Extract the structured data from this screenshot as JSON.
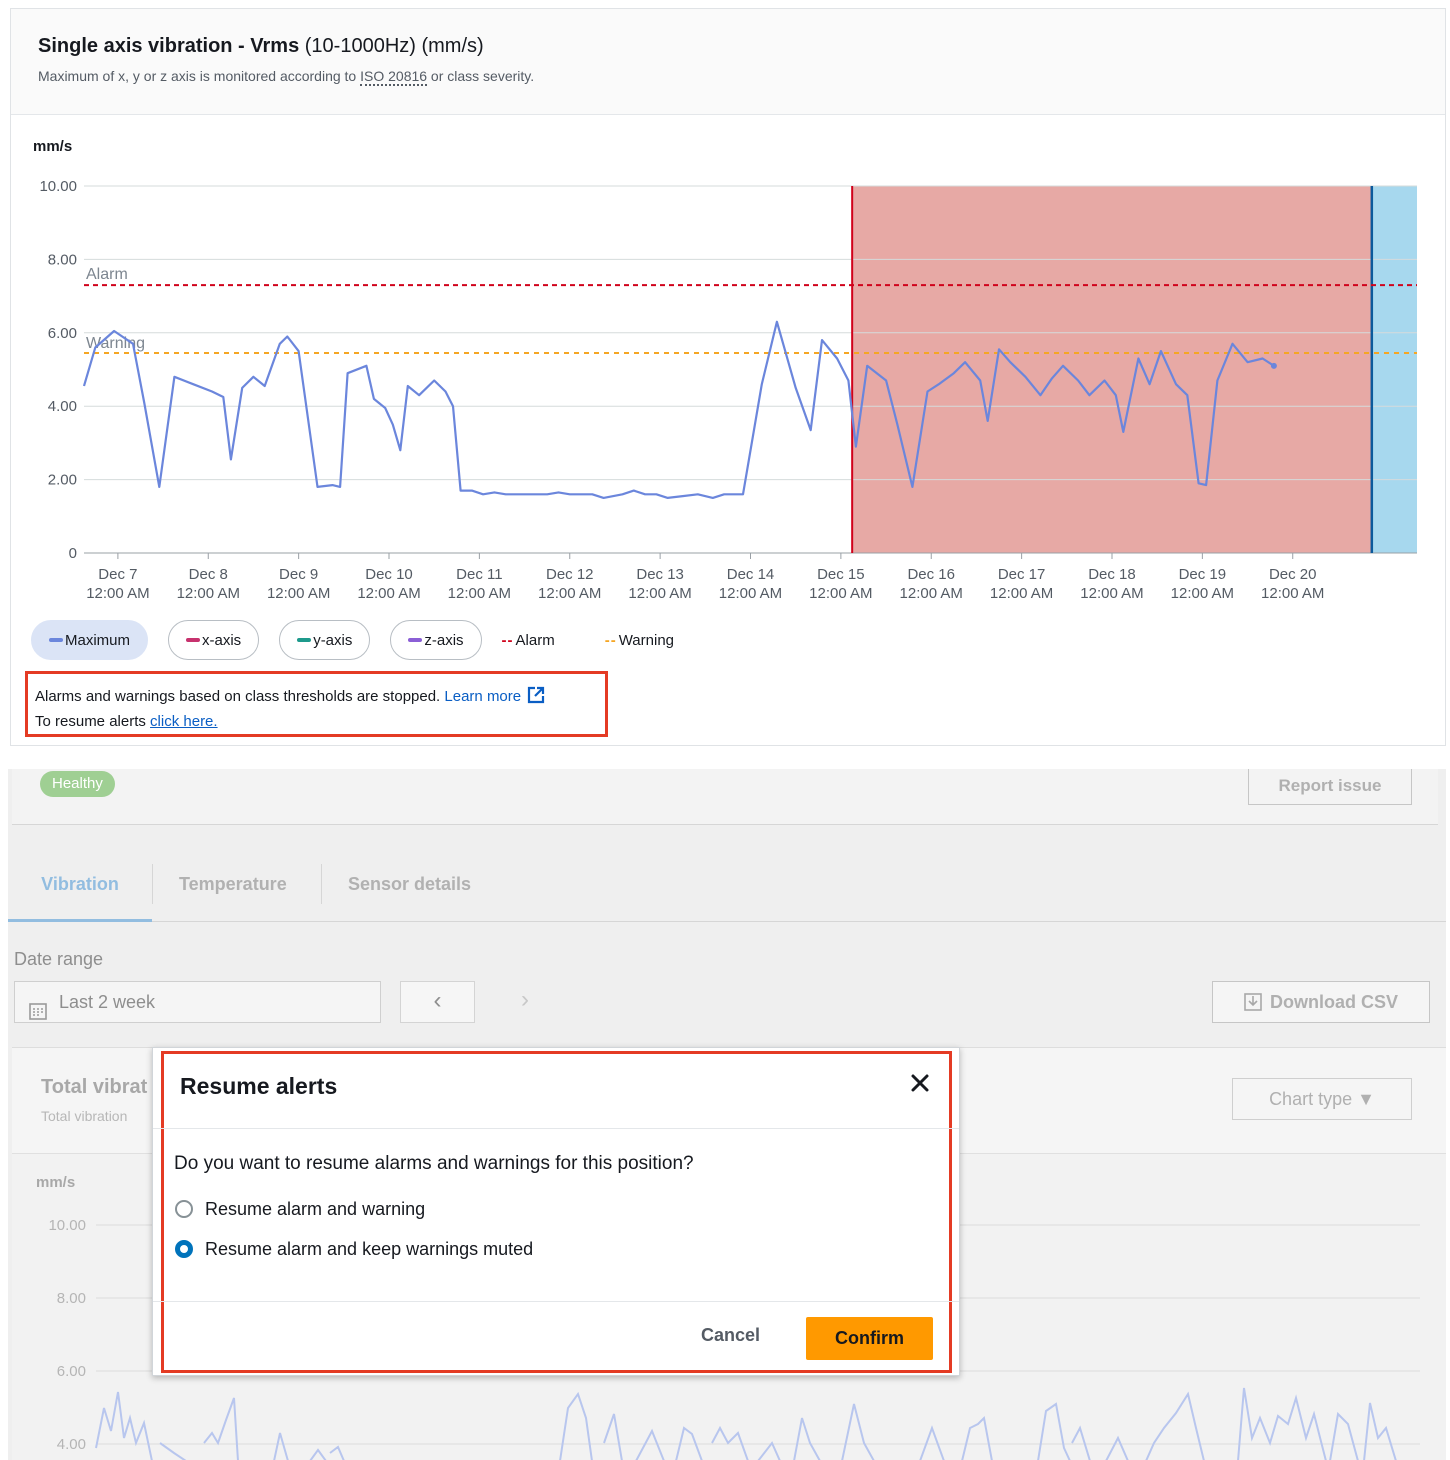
{
  "top": {
    "title_bold": "Single axis vibration - Vrms",
    "title_rest": " (10-1000Hz) (mm/s)",
    "subtitle_pre": "Maximum of x, y or z axis is monitored according to ",
    "subtitle_link": "ISO 20816",
    "subtitle_post": " or class severity.",
    "unit": "mm/s",
    "legend": {
      "maximum": "Maximum",
      "x_axis": "x-axis",
      "y_axis": "y-axis",
      "z_axis": "z-axis",
      "alarm": "Alarm",
      "warning": "Warning",
      "dash": "--"
    },
    "notice": {
      "line1": "Alarms and warnings based on class thresholds are stopped. ",
      "learn_more": "Learn more",
      "line2": "To resume alerts ",
      "click_here": "click here."
    }
  },
  "bottom": {
    "status_badge": "Healthy",
    "report_button": "Report issue",
    "tabs": [
      "Vibration",
      "Temperature",
      "Sensor details"
    ],
    "date_range_label": "Date range",
    "date_range_value": "Last 2 week",
    "prev_symbol": "‹",
    "next_symbol": "›",
    "download_csv": "Download CSV",
    "card_title": "Total vibrat",
    "card_subtitle": "Total vibration",
    "chart_type_label": "Chart type ▼",
    "unit": "mm/s",
    "y_ticks": [
      "10.00",
      "8.00",
      "6.00",
      "4.00"
    ]
  },
  "modal": {
    "title": "Resume alerts",
    "question": "Do you want to resume alarms and warnings for this position?",
    "options": [
      "Resume alarm and warning",
      "Resume alarm and keep warnings muted"
    ],
    "selected_index": 1,
    "cancel": "Cancel",
    "confirm": "Confirm"
  },
  "colors": {
    "maximum": "#6b86dc",
    "x_axis": "#c7326e",
    "y_axis": "#1e9a8c",
    "z_axis": "#8b5fd6",
    "alarm": "#d0021b",
    "warning": "#f5a623",
    "muted_region": "#e7a9a5",
    "current_region": "#a7d8ee",
    "highlight_frame": "#e43b24",
    "confirm_button": "#ff9900"
  },
  "chart_data": {
    "type": "line",
    "ylabel": "mm/s",
    "ylim": [
      0,
      10
    ],
    "y_ticks": [
      "10.00",
      "8.00",
      "6.00",
      "4.00",
      "2.00",
      "0"
    ],
    "x_ticks": [
      {
        "date": "Dec 7",
        "time": "12:00 AM"
      },
      {
        "date": "Dec 8",
        "time": "12:00 AM"
      },
      {
        "date": "Dec 9",
        "time": "12:00 AM"
      },
      {
        "date": "Dec 10",
        "time": "12:00 AM"
      },
      {
        "date": "Dec 11",
        "time": "12:00 AM"
      },
      {
        "date": "Dec 12",
        "time": "12:00 AM"
      },
      {
        "date": "Dec 13",
        "time": "12:00 AM"
      },
      {
        "date": "Dec 14",
        "time": "12:00 AM"
      },
      {
        "date": "Dec 15",
        "time": "12:00 AM"
      },
      {
        "date": "Dec 16",
        "time": "12:00 AM"
      },
      {
        "date": "Dec 17",
        "time": "12:00 AM"
      },
      {
        "date": "Dec 18",
        "time": "12:00 AM"
      },
      {
        "date": "Dec 19",
        "time": "12:00 AM"
      },
      {
        "date": "Dec 20",
        "time": "12:00 AM"
      }
    ],
    "x_start": "2021-12-06T15:00",
    "x_end": "2021-12-21T09:00",
    "thresholds": [
      {
        "name": "Alarm",
        "value": 7.3
      },
      {
        "name": "Warning",
        "value": 5.45
      }
    ],
    "muted_region": {
      "start": "2021-12-15T03:00",
      "end": "2021-12-20T21:00"
    },
    "series": [
      {
        "name": "Maximum",
        "points": [
          [
            "2021-12-06T15:00",
            4.55
          ],
          [
            "2021-12-06T18:00",
            5.6
          ],
          [
            "2021-12-06T23:00",
            6.05
          ],
          [
            "2021-12-07T04:00",
            5.7
          ],
          [
            "2021-12-07T07:00",
            4.1
          ],
          [
            "2021-12-07T11:00",
            1.8
          ],
          [
            "2021-12-07T15:00",
            4.8
          ],
          [
            "2021-12-07T20:00",
            4.6
          ],
          [
            "2021-12-08T01:00",
            4.4
          ],
          [
            "2021-12-08T04:00",
            4.25
          ],
          [
            "2021-12-08T06:00",
            2.55
          ],
          [
            "2021-12-08T09:00",
            4.5
          ],
          [
            "2021-12-08T12:00",
            4.8
          ],
          [
            "2021-12-08T15:00",
            4.55
          ],
          [
            "2021-12-08T19:00",
            5.7
          ],
          [
            "2021-12-08T21:00",
            5.9
          ],
          [
            "2021-12-09T00:00",
            5.5
          ],
          [
            "2021-12-09T05:00",
            1.8
          ],
          [
            "2021-12-09T09:00",
            1.85
          ],
          [
            "2021-12-09T11:00",
            1.8
          ],
          [
            "2021-12-09T13:00",
            4.9
          ],
          [
            "2021-12-09T18:00",
            5.1
          ],
          [
            "2021-12-09T20:00",
            4.2
          ],
          [
            "2021-12-09T23:00",
            3.95
          ],
          [
            "2021-12-10T01:00",
            3.5
          ],
          [
            "2021-12-10T03:00",
            2.8
          ],
          [
            "2021-12-10T05:00",
            4.55
          ],
          [
            "2021-12-10T08:00",
            4.3
          ],
          [
            "2021-12-10T12:00",
            4.7
          ],
          [
            "2021-12-10T15:00",
            4.4
          ],
          [
            "2021-12-10T17:00",
            4.0
          ],
          [
            "2021-12-10T19:00",
            1.7
          ],
          [
            "2021-12-10T22:00",
            1.7
          ],
          [
            "2021-12-11T01:00",
            1.6
          ],
          [
            "2021-12-11T04:00",
            1.65
          ],
          [
            "2021-12-11T07:00",
            1.6
          ],
          [
            "2021-12-11T12:00",
            1.6
          ],
          [
            "2021-12-11T18:00",
            1.6
          ],
          [
            "2021-12-11T21:00",
            1.65
          ],
          [
            "2021-12-12T00:00",
            1.6
          ],
          [
            "2021-12-12T03:00",
            1.6
          ],
          [
            "2021-12-12T06:00",
            1.6
          ],
          [
            "2021-12-12T09:00",
            1.5
          ],
          [
            "2021-12-12T14:00",
            1.6
          ],
          [
            "2021-12-12T17:00",
            1.7
          ],
          [
            "2021-12-12T20:00",
            1.6
          ],
          [
            "2021-12-12T23:00",
            1.6
          ],
          [
            "2021-12-13T02:00",
            1.5
          ],
          [
            "2021-12-13T06:00",
            1.55
          ],
          [
            "2021-12-13T10:00",
            1.6
          ],
          [
            "2021-12-13T14:00",
            1.5
          ],
          [
            "2021-12-13T17:00",
            1.6
          ],
          [
            "2021-12-13T22:00",
            1.6
          ],
          [
            "2021-12-14T03:00",
            4.6
          ],
          [
            "2021-12-14T07:00",
            6.3
          ],
          [
            "2021-12-14T12:00",
            4.5
          ],
          [
            "2021-12-14T16:00",
            3.35
          ],
          [
            "2021-12-14T19:00",
            5.8
          ],
          [
            "2021-12-14T23:00",
            5.3
          ],
          [
            "2021-12-15T02:00",
            4.7
          ],
          [
            "2021-12-15T04:00",
            2.9
          ],
          [
            "2021-12-15T07:00",
            5.1
          ],
          [
            "2021-12-15T12:00",
            4.7
          ],
          [
            "2021-12-15T15:00",
            3.5
          ],
          [
            "2021-12-15T19:00",
            1.8
          ],
          [
            "2021-12-15T23:00",
            4.4
          ],
          [
            "2021-12-16T02:00",
            4.6
          ],
          [
            "2021-12-16T06:00",
            4.9
          ],
          [
            "2021-12-16T09:00",
            5.2
          ],
          [
            "2021-12-16T13:00",
            4.7
          ],
          [
            "2021-12-16T15:00",
            3.6
          ],
          [
            "2021-12-16T18:00",
            5.55
          ],
          [
            "2021-12-16T21:00",
            5.2
          ],
          [
            "2021-12-17T01:00",
            4.8
          ],
          [
            "2021-12-17T05:00",
            4.3
          ],
          [
            "2021-12-17T08:00",
            4.75
          ],
          [
            "2021-12-17T11:00",
            5.1
          ],
          [
            "2021-12-17T15:00",
            4.7
          ],
          [
            "2021-12-17T18:00",
            4.3
          ],
          [
            "2021-12-17T22:00",
            4.7
          ],
          [
            "2021-12-18T01:00",
            4.3
          ],
          [
            "2021-12-18T03:00",
            3.3
          ],
          [
            "2021-12-18T07:00",
            5.3
          ],
          [
            "2021-12-18T10:00",
            4.6
          ],
          [
            "2021-12-18T13:00",
            5.5
          ],
          [
            "2021-12-18T17:00",
            4.6
          ],
          [
            "2021-12-18T20:00",
            4.3
          ],
          [
            "2021-12-18T23:00",
            1.9
          ],
          [
            "2021-12-19T01:00",
            1.85
          ],
          [
            "2021-12-19T04:00",
            4.7
          ],
          [
            "2021-12-19T08:00",
            5.7
          ],
          [
            "2021-12-19T12:00",
            5.2
          ],
          [
            "2021-12-19T16:00",
            5.3
          ],
          [
            "2021-12-19T19:00",
            5.1
          ]
        ]
      }
    ]
  }
}
